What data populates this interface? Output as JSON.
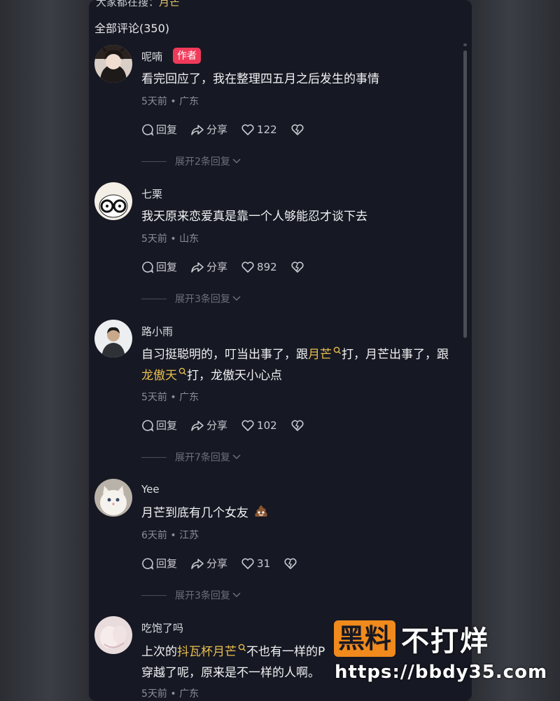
{
  "search_hint": {
    "prefix": "大家都在搜：",
    "keyword": "月芒"
  },
  "comments_total": "全部评论(350)",
  "labels": {
    "reply": "回复",
    "share": "分享"
  },
  "comments": [
    {
      "username": "呢喃",
      "badge": "作者",
      "text": "看完回应了，我在整理四五月之后发生的事情",
      "meta": "5天前 • 广东",
      "likes": "122",
      "expand": "展开2条回复"
    },
    {
      "username": "七栗",
      "text": "我天原来恋爱真是靠一个人够能忍才谈下去",
      "meta": "5天前 • 山东",
      "likes": "892",
      "expand": "展开3条回复"
    },
    {
      "username": "路小雨",
      "text_parts": [
        "自习挺聪明的，叮当出事了，跟",
        "月芒",
        "打，月芒出事了，跟",
        "龙傲天",
        "打，龙傲天小心点"
      ],
      "meta": "5天前 • 广东",
      "likes": "102",
      "expand": "展开7条回复"
    },
    {
      "username": "Yee",
      "text": "月芒到底有几个女友",
      "meta": "6天前 • 江苏",
      "likes": "31",
      "expand": "展开3条回复"
    },
    {
      "username": "吃饱了吗",
      "text_parts": [
        "上次的",
        "抖瓦杯月芒",
        "不也有一样的P",
        "穿越了呢，原来是不一样的人啊。"
      ],
      "meta": "5天前 • 广东"
    }
  ],
  "watermark": {
    "box": "黑料",
    "text": "不打烊",
    "url": "https://bbdy35.com"
  },
  "colors": {
    "panel": "#161823",
    "keyword": "#e8bf4e",
    "author_badge": "#f03a5a",
    "watermark_box": "#f08a1c"
  },
  "icons": [
    "reply-bubble-icon",
    "share-arrow-icon",
    "heart-icon",
    "broken-heart-icon",
    "chevron-down-icon",
    "search-keyword-icon",
    "poop-emoji-icon"
  ]
}
